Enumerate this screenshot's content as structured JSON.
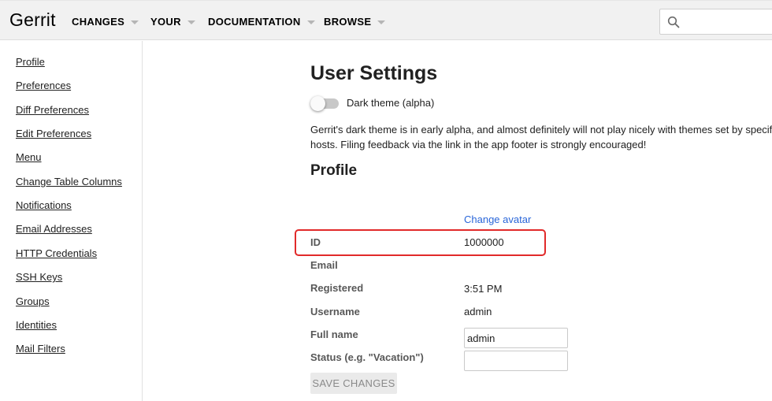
{
  "header": {
    "brand": "Gerrit",
    "nav": [
      {
        "label": "CHANGES"
      },
      {
        "label": "YOUR"
      },
      {
        "label": "DOCUMENTATION"
      },
      {
        "label": "BROWSE"
      }
    ],
    "search": {
      "placeholder": ""
    }
  },
  "sidebar": {
    "items": [
      {
        "label": "Profile"
      },
      {
        "label": "Preferences"
      },
      {
        "label": "Diff Preferences"
      },
      {
        "label": "Edit Preferences"
      },
      {
        "label": "Menu"
      },
      {
        "label": "Change Table Columns"
      },
      {
        "label": "Notifications"
      },
      {
        "label": "Email Addresses"
      },
      {
        "label": "HTTP Credentials"
      },
      {
        "label": "SSH Keys"
      },
      {
        "label": "Groups"
      },
      {
        "label": "Identities"
      },
      {
        "label": "Mail Filters"
      }
    ]
  },
  "main": {
    "title": "User Settings",
    "dark_theme": {
      "label": "Dark theme (alpha)",
      "enabled": false
    },
    "description": "Gerrit's dark theme is in early alpha, and almost definitely will not play nicely with themes set by specific hosts. Filing feedback via the link in the app footer is strongly encouraged!",
    "profile": {
      "heading": "Profile",
      "change_avatar": "Change avatar",
      "id_label": "ID",
      "id_value": "1000000",
      "email_label": "Email",
      "registered_label": "Registered",
      "registered_value": "3:51 PM",
      "username_label": "Username",
      "username_value": "admin",
      "fullname_label": "Full name",
      "fullname_value": "admin",
      "status_label": "Status (e.g. \"Vacation\")",
      "status_value": "",
      "save_label": "SAVE CHANGES"
    }
  },
  "colors": {
    "link": "#2a66d9",
    "highlight": "#e12a2a",
    "header_bg": "#f1f1f1"
  }
}
